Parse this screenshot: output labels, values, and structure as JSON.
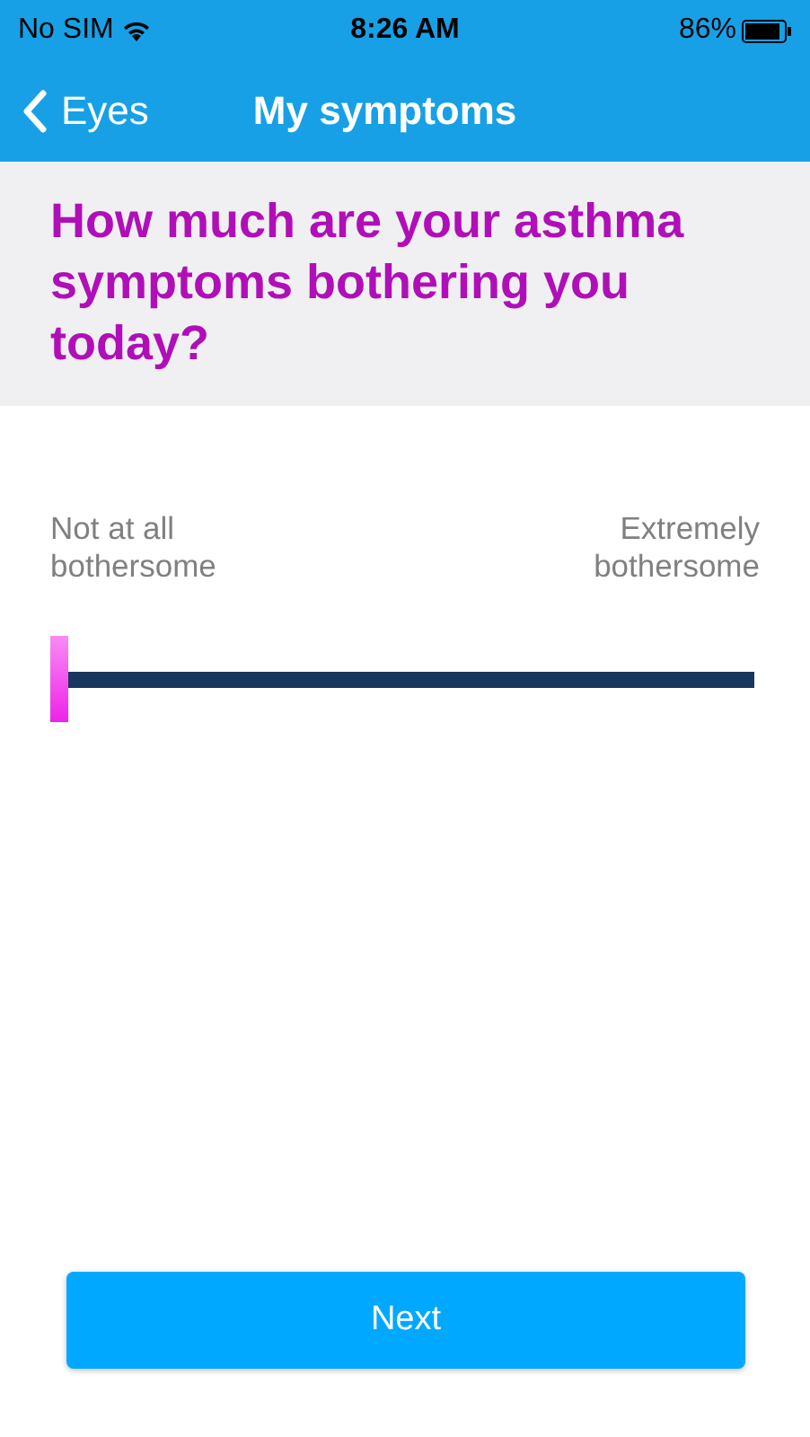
{
  "status_bar": {
    "carrier": "No SIM",
    "time": "8:26 AM",
    "battery": "86%"
  },
  "nav": {
    "back_label": "Eyes",
    "title": "My symptoms"
  },
  "question": "How much are your asthma symptoms bothering you today?",
  "slider": {
    "min_label": "Not at all bothersome",
    "max_label": "Extremely bothersome",
    "level": 0
  },
  "button": "Next"
}
